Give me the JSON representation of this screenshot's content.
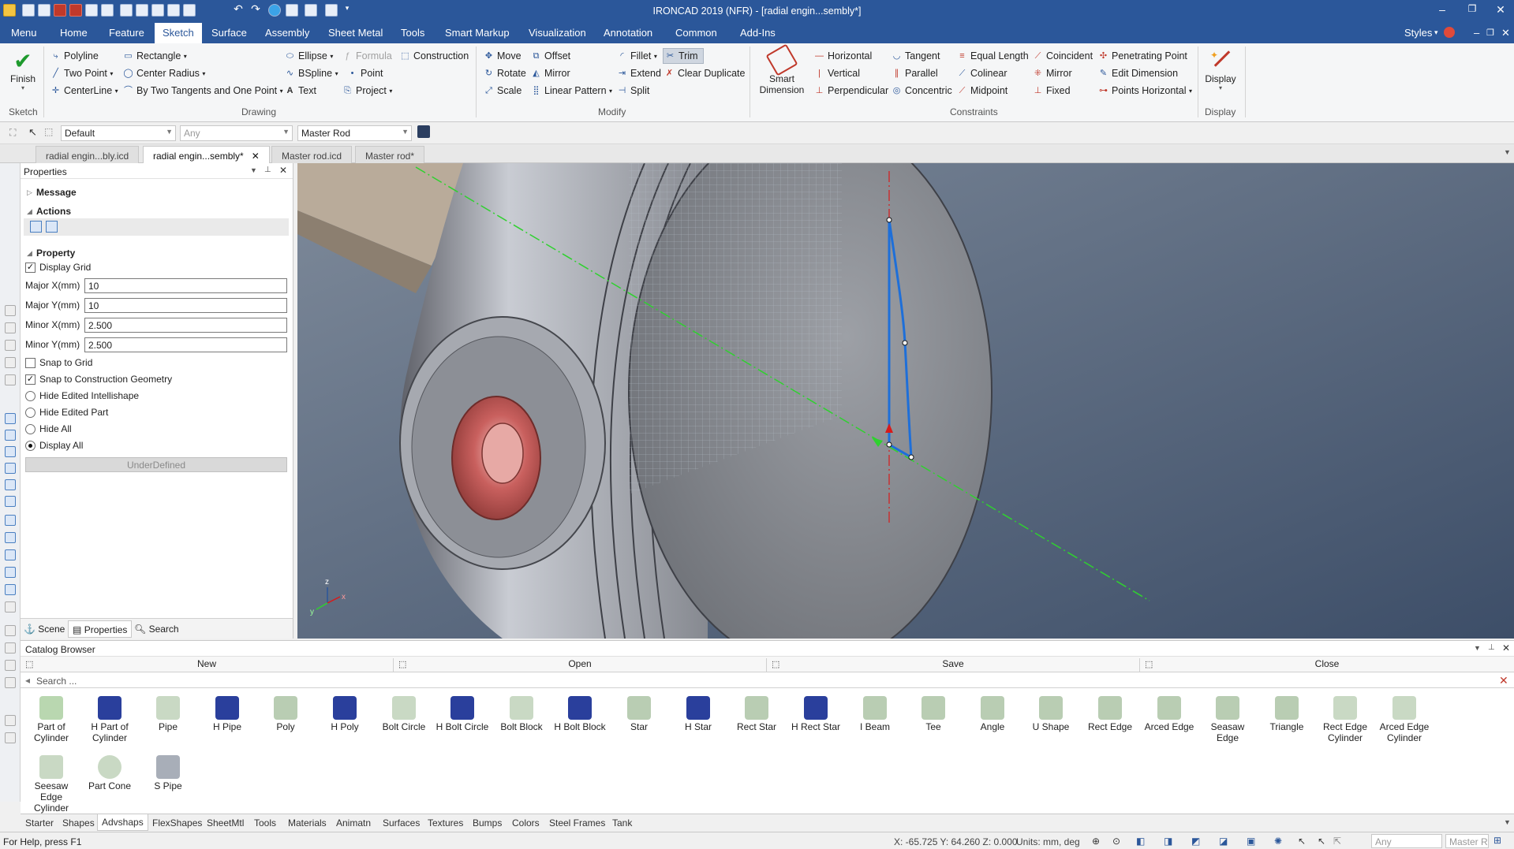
{
  "app": {
    "title": "IRONCAD 2019 (NFR) - [radial engin...sembly*]"
  },
  "menu": {
    "tabs": [
      "Menu",
      "Home",
      "Feature",
      "Sketch",
      "Surface",
      "Assembly",
      "Sheet Metal",
      "Tools",
      "Smart Markup",
      "Visualization",
      "Annotation",
      "Common",
      "Add-Ins"
    ],
    "styles_label": "Styles"
  },
  "ribbon": {
    "sketch_group": {
      "finish": "Finish",
      "label": "Sketch"
    },
    "drawing": {
      "polyline": "Polyline",
      "rectangle": "Rectangle",
      "ellipse": "Ellipse",
      "formula": "Formula",
      "construction": "Construction",
      "two_point": "Two Point",
      "center_radius": "Center Radius",
      "bspline": "BSpline",
      "point": "Point",
      "centerline": "CenterLine",
      "by_two_tangents": "By Two Tangents and One Point",
      "text": "Text",
      "project": "Project",
      "label": "Drawing"
    },
    "modify": {
      "move": "Move",
      "offset": "Offset",
      "fillet": "Fillet",
      "trim": "Trim",
      "rotate": "Rotate",
      "mirror": "Mirror",
      "extend": "Extend",
      "clear_duplicate": "Clear Duplicate",
      "scale": "Scale",
      "linear_pattern": "Linear Pattern",
      "split": "Split",
      "label": "Modify"
    },
    "constraints": {
      "smart_dimension": "Smart Dimension",
      "horizontal": "Horizontal",
      "tangent": "Tangent",
      "equal_length": "Equal Length",
      "coincident": "Coincident",
      "penetrating_point": "Penetrating Point",
      "vertical": "Vertical",
      "parallel": "Parallel",
      "colinear": "Colinear",
      "mirror": "Mirror",
      "edit_dimension": "Edit Dimension",
      "perpendicular": "Perpendicular",
      "concentric": "Concentric",
      "midpoint": "Midpoint",
      "fixed": "Fixed",
      "points_horizontal": "Points Horizontal",
      "label": "Constraints"
    },
    "display": {
      "button": "Display",
      "label": "Display"
    }
  },
  "toolbar2": {
    "style_combo": "Default",
    "filter_combo": "Any",
    "part_combo": "Master Rod"
  },
  "doc_tabs": [
    "radial engin...bly.icd",
    "radial engin...sembly*",
    "Master rod.icd",
    "Master rod*"
  ],
  "properties": {
    "title": "Properties",
    "sections": {
      "message": "Message",
      "actions": "Actions",
      "property": "Property"
    },
    "display_grid": "Display Grid",
    "fields": [
      {
        "label": "Major X(mm)",
        "value": "10"
      },
      {
        "label": "Major Y(mm)",
        "value": "10"
      },
      {
        "label": "Minor X(mm)",
        "value": "2.500"
      },
      {
        "label": "Minor Y(mm)",
        "value": "2.500"
      }
    ],
    "snap_to_grid": "Snap to Grid",
    "snap_to_construction": "Snap to Construction Geometry",
    "radios": [
      "Hide Edited Intellishape",
      "Hide Edited Part",
      "Hide All",
      "Display All"
    ],
    "status_button": "UnderDefined",
    "bottom_tabs": [
      "Scene",
      "Properties",
      "Search"
    ]
  },
  "catalog": {
    "title": "Catalog Browser",
    "buttons": [
      "New",
      "Open",
      "Save",
      "Close"
    ],
    "search_placeholder": "Search ...",
    "items": [
      "Part of Cylinder",
      "H Part of Cylinder",
      "Pipe",
      "H Pipe",
      "Poly",
      "H Poly",
      "Bolt Circle",
      "H Bolt Circle",
      "Bolt Block",
      "H Bolt Block",
      "Star",
      "H Star",
      "Rect Star",
      "H Rect Star",
      "I Beam",
      "Tee",
      "Angle",
      "U Shape",
      "Rect Edge",
      "Arced Edge",
      "Seasaw Edge",
      "Triangle",
      "Rect Edge Cylinder",
      "Arced Edge Cylinder",
      "Seesaw Edge Cylinder",
      "Part Cone",
      "S Pipe"
    ],
    "tabs": [
      "Starter",
      "Shapes",
      "Advshaps",
      "FlexShapes",
      "SheetMtl",
      "Tools",
      "Materials",
      "Animatn",
      "Surfaces",
      "Textures",
      "Bumps",
      "Colors",
      "Steel Frames",
      "Tank"
    ]
  },
  "status": {
    "help": "For Help, press F1",
    "coords": "X: -65.725 Y: 64.260 Z: 0.000",
    "units": "Units: mm, deg",
    "combo1": "Any",
    "combo2": "Master R"
  },
  "triad": {
    "z": "z",
    "x": "x",
    "y": "y"
  },
  "colors": {
    "accent": "#2b579a",
    "sketch_blue": "#1e6fd9",
    "piston_pin": "#c9605e"
  }
}
